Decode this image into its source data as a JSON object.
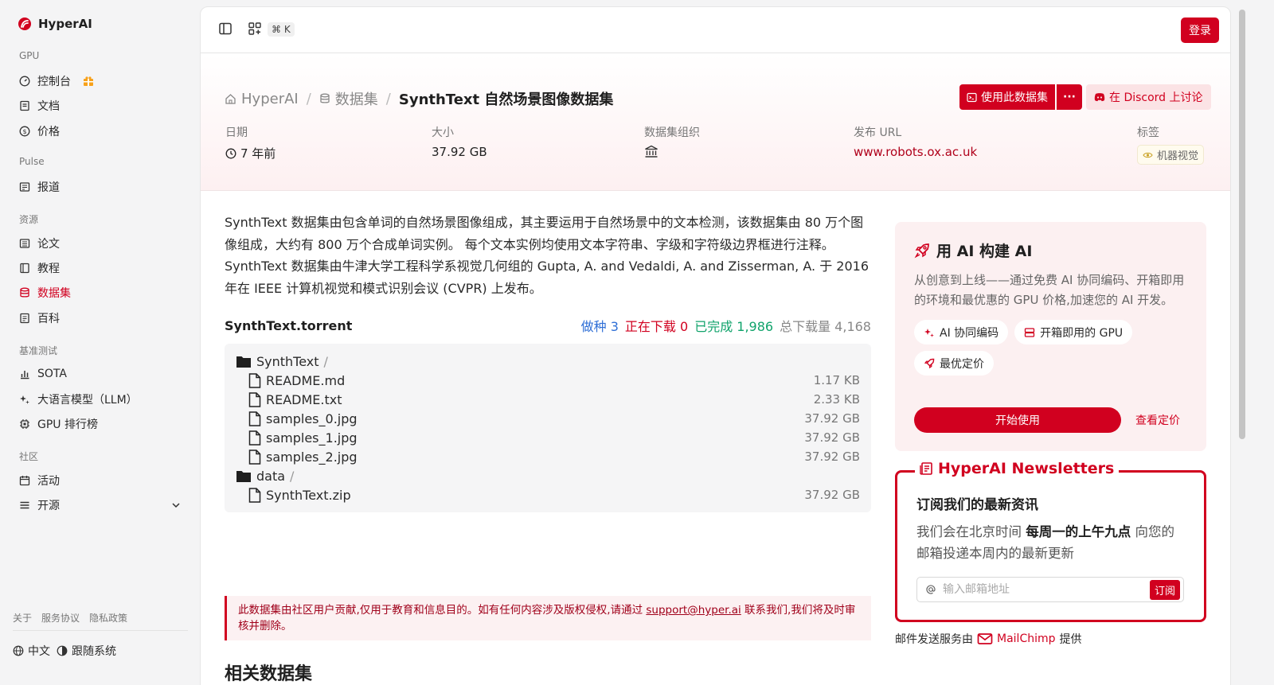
{
  "brand": {
    "name": "HyperAI"
  },
  "sidebar": {
    "sections": [
      {
        "title": "GPU",
        "items": [
          {
            "label": "控制台",
            "icon": "gauge-icon"
          },
          {
            "label": "文档",
            "icon": "document-icon"
          },
          {
            "label": "价格",
            "icon": "dollar-icon"
          }
        ]
      },
      {
        "title": "Pulse",
        "items": [
          {
            "label": "报道",
            "icon": "newspaper-icon"
          }
        ]
      },
      {
        "title": "资源",
        "items": [
          {
            "label": "论文",
            "icon": "paper-icon"
          },
          {
            "label": "教程",
            "icon": "book-icon"
          },
          {
            "label": "数据集",
            "icon": "database-icon",
            "active": true
          },
          {
            "label": "百科",
            "icon": "encyclopedia-icon"
          }
        ]
      },
      {
        "title": "基准测试",
        "items": [
          {
            "label": "SOTA",
            "icon": "bar-chart-icon"
          },
          {
            "label": "大语言模型（LLM）",
            "icon": "sparkles-icon"
          },
          {
            "label": "GPU 排行榜",
            "icon": "cpu-icon"
          }
        ]
      },
      {
        "title": "社区",
        "items": [
          {
            "label": "活动",
            "icon": "calendar-icon"
          },
          {
            "label": "开源",
            "icon": "menu-icon"
          }
        ]
      }
    ],
    "footer_links": [
      "关于",
      "服务协议",
      "隐私政策"
    ],
    "language": "中文",
    "theme": "跟随系统"
  },
  "topbar": {
    "shortcut": "⌘ K",
    "login": "登录"
  },
  "breadcrumb": {
    "home": "HyperAI",
    "section": "数据集",
    "current": "SynthText 自然场景图像数据集"
  },
  "actions": {
    "use_dataset": "使用此数据集",
    "more": "···",
    "discord": "在 Discord 上讨论"
  },
  "meta": {
    "date_label": "日期",
    "date_value": "7 年前",
    "size_label": "大小",
    "size_value": "37.92 GB",
    "org_label": "数据集组织",
    "url_label": "发布 URL",
    "url_value": "www.robots.ox.ac.uk",
    "tags_label": "标签",
    "tag_value": "机器视觉"
  },
  "description": {
    "line1": "SynthText 数据集由包含单词的自然场景图像组成，其主要运用于自然场景中的文本检测，该数据集由 80 万个图像组成，大约有 800 万个合成单词实例。 每个文本实例均使用文本字符串、字级和字符级边界框进行注释。",
    "line2": "SynthText 数据集由牛津大学工程科学系视觉几何组的 Gupta, A. and Vedaldi, A. and Zisserman, A. 于 2016 年在 IEEE 计算机视觉和模式识别会议 (CVPR) 上发布。"
  },
  "torrent": {
    "name": "SynthText.torrent",
    "seeds": "做种 3",
    "downloading": "正在下载 0",
    "completed": "已完成 1,986",
    "total": "总下载量 4,168",
    "files": [
      {
        "name": "SynthText",
        "type": "folder"
      },
      {
        "name": "README.md",
        "type": "file",
        "size": "1.17 KB"
      },
      {
        "name": "README.txt",
        "type": "file",
        "size": "2.33 KB"
      },
      {
        "name": "samples_0.jpg",
        "type": "file",
        "size": "37.92 GB"
      },
      {
        "name": "samples_1.jpg",
        "type": "file",
        "size": "37.92 GB"
      },
      {
        "name": "samples_2.jpg",
        "type": "file",
        "size": "37.92 GB"
      },
      {
        "name": "data",
        "type": "folder"
      },
      {
        "name": "SynthText.zip",
        "type": "file",
        "size": "37.92 GB"
      }
    ]
  },
  "notice": {
    "before": "此数据集由社区用户贡献,仅用于教育和信息目的。如有任何内容涉及版权侵权,请通过 ",
    "email": "support@hyper.ai",
    "after": " 联系我们,我们将及时审核并删除。"
  },
  "related_title": "相关数据集",
  "ai_card": {
    "title": "用 AI 构建 AI",
    "desc": "从创意到上线——通过免费 AI 协同编码、开箱即用的环境和最优惠的 GPU 价格,加速您的 AI 开发。",
    "chips": [
      "AI 协同编码",
      "开箱即用的 GPU",
      "最优定价"
    ],
    "start": "开始使用",
    "pricing": "查看定价"
  },
  "newsletter": {
    "title": "HyperAI Newsletters",
    "subtitle": "订阅我们的最新资讯",
    "text_before": "我们会在北京时间 ",
    "text_bold": "每周一的上午九点",
    "text_after": " 向您的邮箱投递本周内的最新更新",
    "placeholder": "输入邮箱地址",
    "subscribe": "订阅",
    "provider_before": "邮件发送服务由",
    "provider": "MailChimp",
    "provider_after": "提供"
  },
  "colors": {
    "accent": "#d1001f",
    "seed": "#2f6fd6",
    "done": "#10a36b"
  }
}
